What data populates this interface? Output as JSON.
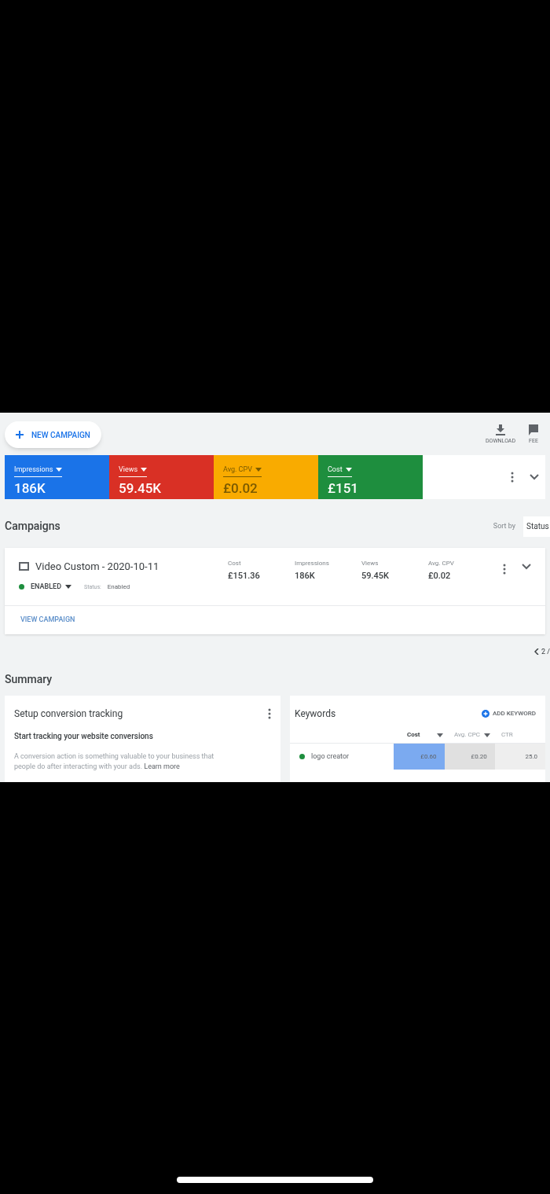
{
  "toolbar": {
    "new_campaign": "NEW CAMPAIGN",
    "actions": [
      {
        "kind": "download",
        "label": "DOWNLOAD"
      },
      {
        "kind": "feedback",
        "label": "FEE"
      }
    ]
  },
  "metrics": [
    {
      "label": "Impressions",
      "value": "186K",
      "color": "#1a73e8"
    },
    {
      "label": "Views",
      "value": "59.45K",
      "color": "#d93025"
    },
    {
      "label": "Avg. CPV",
      "value": "£0.02",
      "color": "#f9ab00"
    },
    {
      "label": "Cost",
      "value": "£151",
      "color": "#1e8e3e"
    }
  ],
  "campaigns": {
    "title": "Campaigns",
    "sort_label": "Sort by",
    "sort_value": "Status",
    "items": [
      {
        "name": "Video Custom - 2020-10-11",
        "status": "ENABLED",
        "color": "#1e8e3e",
        "status_label": "Status:",
        "status_value": "Enabled",
        "stats": [
          {
            "label": "Cost",
            "value": "£151.36"
          },
          {
            "label": "Impressions",
            "value": "186K"
          },
          {
            "label": "Views",
            "value": "59.45K"
          },
          {
            "label": "Avg. CPV",
            "value": "£0.02"
          }
        ],
        "link": "VIEW CAMPAIGN"
      }
    ],
    "pagination": "2 /"
  },
  "summary": {
    "title": "Summary",
    "conversion": {
      "title": "Setup conversion tracking",
      "heading": "Start tracking your website conversions",
      "body": "A conversion action is something valuable to your business that people do after interacting with your ads.",
      "link": "Learn more"
    },
    "keywords": {
      "title": "Keywords",
      "add": "ADD KEYWORD",
      "columns": [
        {
          "label": "Cost",
          "sortable": true,
          "bold": true
        },
        {
          "label": "Avg. CPC",
          "sortable": true,
          "bold": false
        },
        {
          "label": "CTR",
          "sortable": false,
          "bold": false
        }
      ],
      "rows": [
        {
          "keyword": "logo creator",
          "color": "#1e8e3e",
          "cells": [
            "£0.60",
            "£0.20",
            "25.0"
          ]
        }
      ]
    }
  }
}
